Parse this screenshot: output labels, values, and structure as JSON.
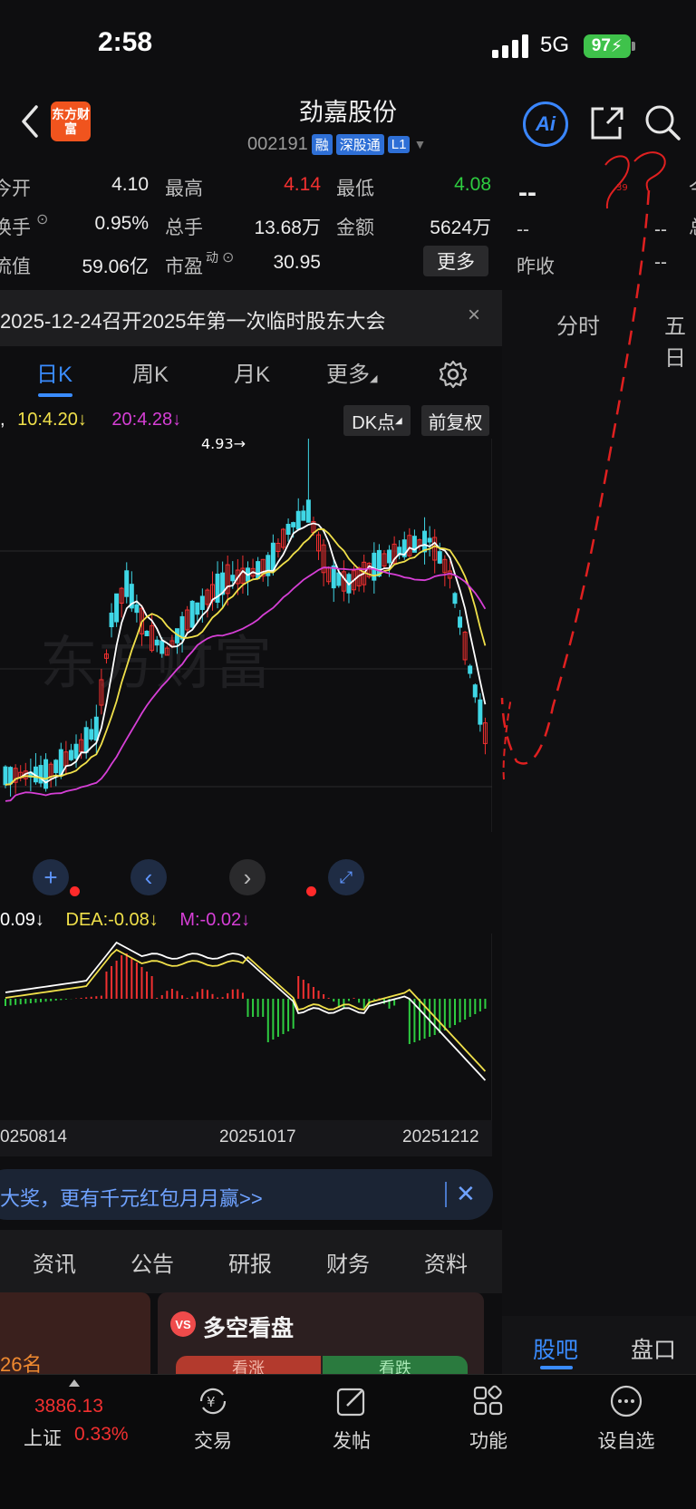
{
  "status": {
    "time": "2:58",
    "network": "5G",
    "battery": "97"
  },
  "header": {
    "logo": "东方财富",
    "stock_name": "劲嘉股份",
    "code": "002191",
    "tags": [
      "融",
      "深股通",
      "L1"
    ],
    "ai_label": "Ai"
  },
  "quote": {
    "row1": {
      "l1": "今开",
      "v1": "4.10",
      "l2": "最高",
      "v2": "4.14",
      "l3": "最低",
      "v3": "4.08"
    },
    "row2": {
      "l1": "换手",
      "v1": "0.95%",
      "l2": "总手",
      "v2": "13.68万",
      "l3": "金额",
      "v3": "5624万"
    },
    "row3": {
      "l1": "流值",
      "v1": "59.06亿",
      "l2": "市盈",
      "l2_sup": "动",
      "v2": "30.95",
      "more": "更多"
    }
  },
  "right_panel": {
    "big": "--",
    "r2_a": "--",
    "r2_b": "--",
    "r3_label": "昨收",
    "r3_val": "--",
    "tab_fenshi": "分时",
    "tab_wuri": "五日",
    "edge1": "今",
    "edge2": "总",
    "annotation": "39"
  },
  "notice": {
    "text": "2025-12-24召开2025年第一次临时股东大会",
    "close": "×"
  },
  "period_tabs": [
    "日K",
    "周K",
    "月K",
    "更多"
  ],
  "ma_legend": {
    "ma10": "10:4.20↓",
    "ma20": "20:4.28↓"
  },
  "chart_buttons": {
    "dk": "DK点",
    "fuquan": "前复权"
  },
  "kline_annotation": "4.93→",
  "macd_legend": {
    "dif": "0.09↓",
    "dea": "DEA:-0.08↓",
    "m": "M:-0.02↓"
  },
  "dates": [
    "0250814",
    "20251017",
    "20251212"
  ],
  "promo": {
    "text": "大奖，更有千元红包月月赢>>",
    "close": "✕"
  },
  "info_tabs": [
    "资讯",
    "公告",
    "研报",
    "财务",
    "资料"
  ],
  "cards": {
    "left_text": "26名",
    "right_title": "多空看盘",
    "bull": "看涨",
    "bear": "看跌",
    "vs": "VS"
  },
  "right_tabs": {
    "guba": "股吧",
    "pankou": "盘口"
  },
  "bottom_nav": {
    "index_value": "3886.13",
    "index_name": "上证",
    "index_pct": "0.33%",
    "items": [
      "交易",
      "发帖",
      "功能",
      "设自选"
    ]
  },
  "colors": {
    "up": "#f23030",
    "down": "#3fd7e6",
    "ma5": "#ffffff",
    "ma10": "#f0e04a",
    "ma20": "#d63fd6",
    "accent": "#3a8cff"
  }
}
